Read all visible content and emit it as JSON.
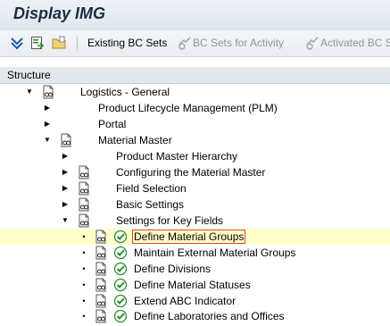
{
  "window": {
    "title": "Display IMG"
  },
  "toolbar": {
    "existing_bc_sets": "Existing BC Sets",
    "bc_sets_for_activity": "BC Sets for Activity",
    "activated_bc_sets": "Activated BC S"
  },
  "tree": {
    "header": "Structure",
    "nodes": [
      {
        "label": "Logistics - General",
        "state": "expanded",
        "icon": "document-glasses-icon"
      },
      {
        "label": "Product Lifecycle Management (PLM)",
        "state": "collapsed"
      },
      {
        "label": "Portal",
        "state": "collapsed"
      },
      {
        "label": "Material Master",
        "state": "expanded",
        "icon": "document-glasses-icon"
      },
      {
        "label": "Product Master Hierarchy",
        "state": "collapsed"
      },
      {
        "label": "Configuring the Material Master",
        "state": "collapsed",
        "icon": "document-glasses-icon"
      },
      {
        "label": "Field Selection",
        "state": "collapsed",
        "icon": "document-glasses-icon"
      },
      {
        "label": "Basic Settings",
        "state": "collapsed",
        "icon": "document-glasses-icon"
      },
      {
        "label": "Settings for Key Fields",
        "state": "expanded",
        "icon": "document-glasses-icon"
      },
      {
        "label": "Define Material Groups",
        "state": "leaf",
        "selected": true
      },
      {
        "label": "Maintain External Material Groups",
        "state": "leaf"
      },
      {
        "label": "Define Divisions",
        "state": "leaf"
      },
      {
        "label": "Define Material Statuses",
        "state": "leaf"
      },
      {
        "label": "Extend ABC Indicator",
        "state": "leaf"
      },
      {
        "label": "Define Laboratories and Offices",
        "state": "leaf"
      }
    ]
  },
  "colors": {
    "selected_row": "#ffffcc",
    "selected_outline": "#d94b35",
    "execute_icon": "#2e8b2e"
  }
}
